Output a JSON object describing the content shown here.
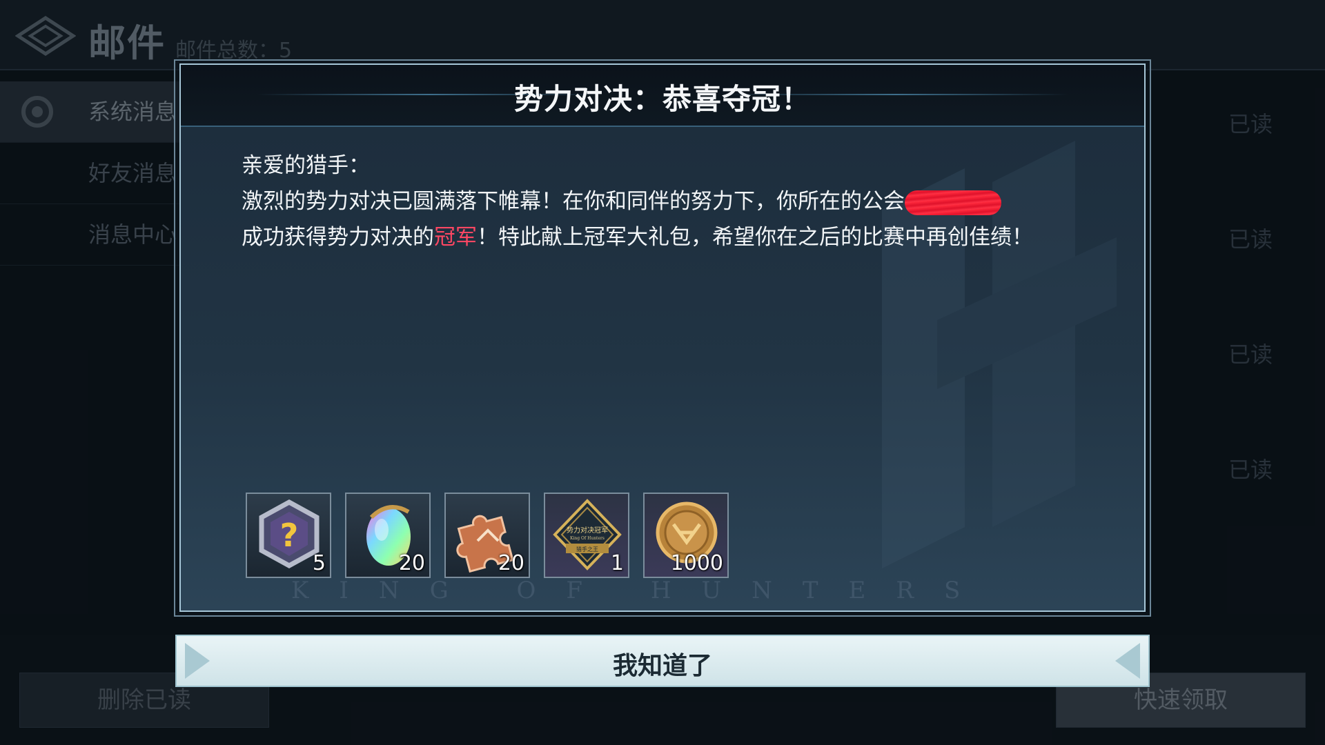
{
  "background": {
    "title": "邮件",
    "mail_count": "邮件总数：5",
    "tabs": [
      {
        "label": "系统消息"
      },
      {
        "label": "好友消息"
      },
      {
        "label": "消息中心"
      }
    ],
    "read_labels": [
      "已读",
      "已读",
      "已读",
      "已读"
    ],
    "delete_button": "删除已读",
    "claim_button": "快速领取"
  },
  "modal": {
    "title": "势力对决：恭喜夺冠！",
    "greeting": "亲爱的猎手：",
    "body_part1": "激烈的势力对决已圆满落下帷幕！在你和同伴的努力下，你所在的公会",
    "body_part2": "成功获得势力对决的",
    "highlight": "冠军",
    "body_part3": "！特此献上冠军大礼包，希望你在之后的比赛中再创佳绩！",
    "watermark": "KING OF HUNTERS",
    "rewards": [
      {
        "icon": "mystery-box-icon",
        "quantity": "5"
      },
      {
        "icon": "rainbow-crystal-icon",
        "quantity": "20"
      },
      {
        "icon": "puzzle-fragment-icon",
        "quantity": "20"
      },
      {
        "icon": "champion-badge-icon",
        "quantity": "1",
        "badge_text": "势力对决冠军",
        "badge_sub": "King Of Hunters",
        "badge_ribbon": "猎手之王"
      },
      {
        "icon": "gold-coin-icon",
        "quantity": "1000"
      }
    ],
    "confirm_button": "我知道了"
  },
  "colors": {
    "highlight": "#ff4763",
    "modal_border": "#a7c7d8",
    "confirm_bg": "#e9f4f6"
  }
}
